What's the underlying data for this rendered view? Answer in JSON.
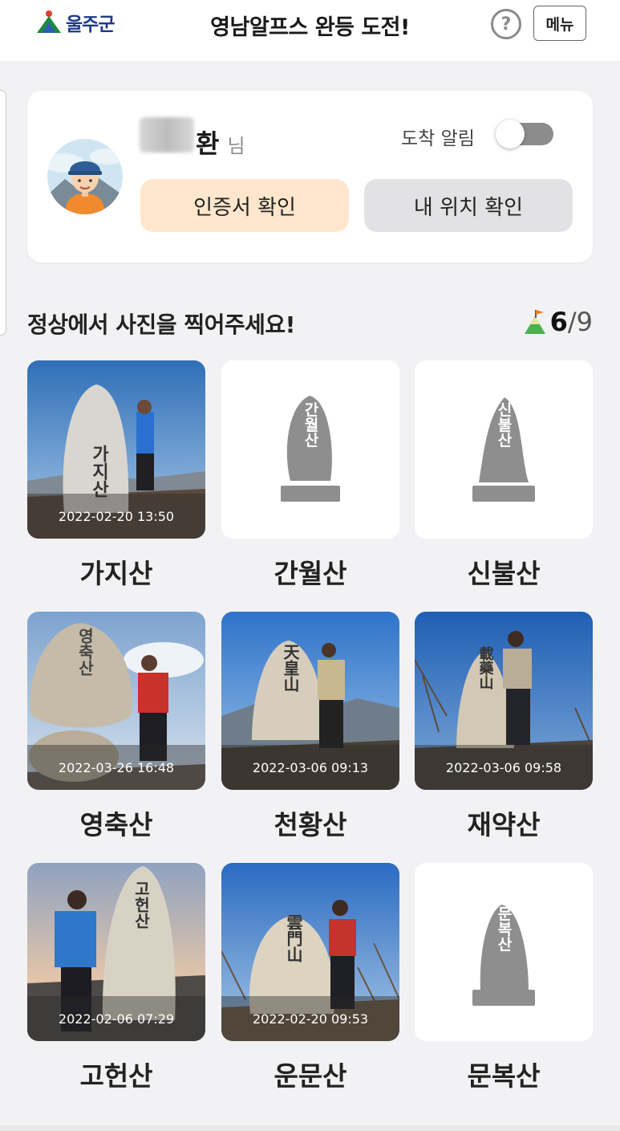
{
  "header": {
    "logo_text": "울주군",
    "title": "영남알프스 완등 도전!",
    "help_symbol": "?",
    "menu_label": "메뉴"
  },
  "profile": {
    "name_suffix": "환",
    "honorific": "님",
    "arrival_alert_label": "도착 알림",
    "arrival_alert_on": false,
    "certificate_button": "인증서 확인",
    "location_button": "내 위치 확인"
  },
  "section": {
    "title": "정상에서 사진을 찍어주세요!",
    "completed": "6",
    "separator": "/",
    "total": "9"
  },
  "mountains": [
    {
      "name": "가지산",
      "timestamp": "2022-02-20 13:50",
      "stone_text": "가지산",
      "done": true
    },
    {
      "name": "간월산",
      "timestamp": "",
      "stone_text": "간월산",
      "done": false
    },
    {
      "name": "신불산",
      "timestamp": "",
      "stone_text": "신불산",
      "done": false
    },
    {
      "name": "영축산",
      "timestamp": "2022-03-26 16:48",
      "stone_text": "영축산",
      "done": true
    },
    {
      "name": "천황산",
      "timestamp": "2022-03-06 09:13",
      "stone_text": "天皇山",
      "done": true
    },
    {
      "name": "재약산",
      "timestamp": "2022-03-06 09:58",
      "stone_text": "載藥山",
      "done": true
    },
    {
      "name": "고헌산",
      "timestamp": "2022-02-06 07:29",
      "stone_text": "고헌산",
      "done": true
    },
    {
      "name": "운문산",
      "timestamp": "2022-02-20 09:53",
      "stone_text": "雲門山",
      "done": true
    },
    {
      "name": "문복산",
      "timestamp": "",
      "stone_text": "문복산",
      "done": false
    }
  ],
  "colors": {
    "accent_orange": "#ffe6cc",
    "button_gray": "#e2e2e4",
    "toggle_off": "#8c8c8c",
    "silhouette": "#8e8e8e"
  }
}
